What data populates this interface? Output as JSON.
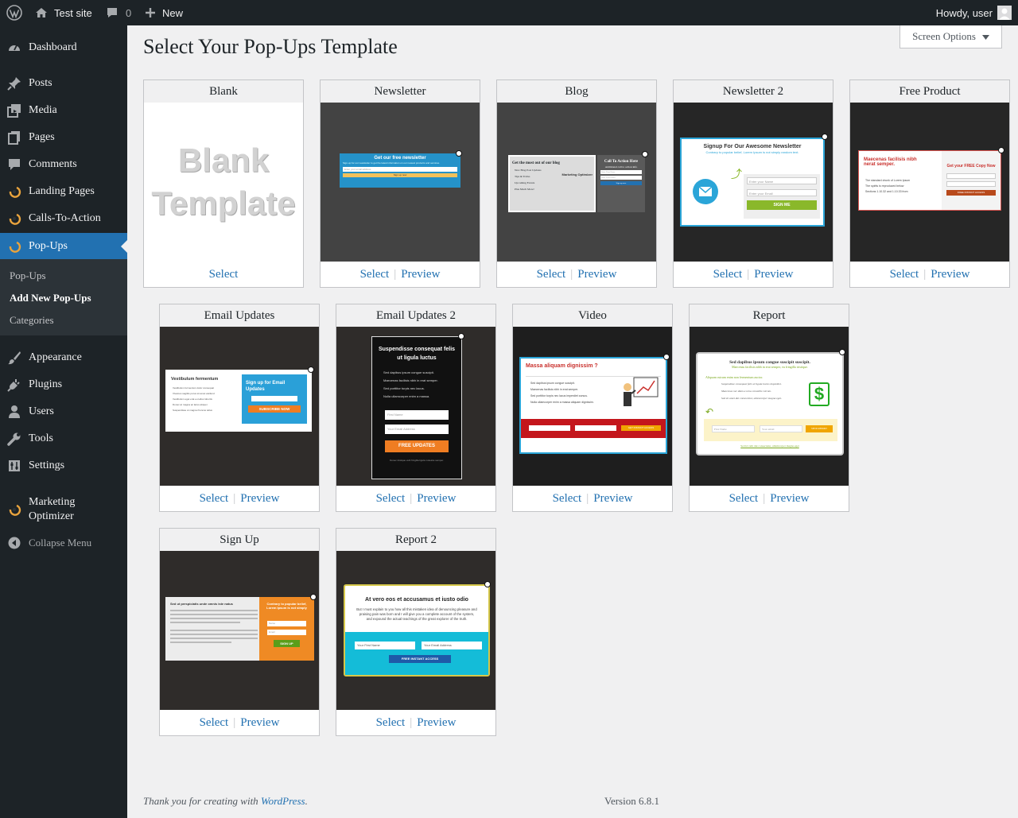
{
  "admin_bar": {
    "site_name": "Test site",
    "comments_count": "0",
    "new_label": "New",
    "greeting": "Howdy, user"
  },
  "sidebar": {
    "items": [
      {
        "label": "Dashboard",
        "icon": "dashboard-icon"
      },
      {
        "label": "Posts",
        "icon": "pin-icon"
      },
      {
        "label": "Media",
        "icon": "media-icon"
      },
      {
        "label": "Pages",
        "icon": "pages-icon"
      },
      {
        "label": "Comments",
        "icon": "comment-icon"
      },
      {
        "label": "Landing Pages",
        "icon": "inbound-icon"
      },
      {
        "label": "Calls-To-Action",
        "icon": "inbound-icon"
      },
      {
        "label": "Pop-Ups",
        "icon": "inbound-icon"
      },
      {
        "label": "Appearance",
        "icon": "brush-icon"
      },
      {
        "label": "Plugins",
        "icon": "plug-icon"
      },
      {
        "label": "Users",
        "icon": "user-icon"
      },
      {
        "label": "Tools",
        "icon": "wrench-icon"
      },
      {
        "label": "Settings",
        "icon": "settings-icon"
      },
      {
        "label": "Marketing Optimizer",
        "icon": "inbound-icon"
      },
      {
        "label": "Collapse Menu",
        "icon": "collapse-icon"
      }
    ],
    "submenu": [
      "Pop-Ups",
      "Add New Pop-Ups",
      "Categories"
    ]
  },
  "page_title": "Select Your Pop-Ups Template",
  "screen_options_label": "Screen Options",
  "select_label": "Select",
  "preview_label": "Preview",
  "templates": [
    {
      "name": "Blank",
      "blank_text": "Blank Template"
    },
    {
      "name": "Newsletter",
      "heading": "Get our free newsletter",
      "body": "Sign-up for our newsletter to get the latest information on our newest products and services.",
      "placeholder": "Enter your email address",
      "button": "Sign up now"
    },
    {
      "name": "Blog",
      "heading": "Get the most out of our blog",
      "bullets": [
        "New Blog Post Updates",
        "Tips & Tricks",
        "Upcoming Events",
        "Plus Much More!"
      ],
      "brand": "Marketing Optimizer",
      "cta_title": "Call To Action Here",
      "cta_sub": "Additional call to action info",
      "field1": "Enter Your Name",
      "field2": "Enter Your Email",
      "button": "Sign up now"
    },
    {
      "name": "Newsletter 2",
      "heading": "Signup For Our Awesome Newsletter",
      "sub": "Contrary to popular belief, Lorem Ipsum is not simply random text.",
      "field1": "Enter your Name",
      "field2": "Enter your Email",
      "button": "SIGN ME"
    },
    {
      "name": "Free Product",
      "heading": "Maecenas facilisis nibh nerat semper.",
      "bullets": [
        "The standard chunk of Lorem Ipsum",
        "The spirits is reproduced below",
        "Sections 1.10.32 and 1.10.33 from"
      ],
      "title2": "Get your FREE Copy Now",
      "button": "FREE INSTANT ACCESS"
    },
    {
      "name": "Email Updates",
      "heading": "Vestibulum fermentum",
      "bullets": [
        "Vestibulum fermentum dolor consequat",
        "Vivamus sagittis purus sit amet eleifend",
        "Vestibulum eget erat eu tellus lobortis",
        "Donec at magna ac lacus aliquet",
        "Suspendisse ut magna rhoncus tellus"
      ],
      "box_title": "Sign up for Email Updates",
      "button": "SUBSCRIBE NOW"
    },
    {
      "name": "Email Updates 2",
      "heading": "Suspendisse consequat felis ut ligula luctus",
      "bullets": [
        "Sed dapibus ipsum congue suscipit.",
        "Maecenas facilisis nibh in erat semper.",
        "Sed porttitor turpis nec lacus.",
        "Nulla ullamcorper enim a massa."
      ],
      "field1": "First Name",
      "field2": "Your Email Address",
      "button": "FREE UPDATES",
      "foot": "Donec tristique velit fringilla ligula molestie semper."
    },
    {
      "name": "Video",
      "heading": "Massa aliquam dignissim ?",
      "bullets": [
        "Sed dapibus ipsum congue suscipit.",
        "Maecenas facilisis nibh in erat semper.",
        "Sed porttitor turpis nec lacus imperdiet cursus.",
        "Nulla ullamcorper enim a massa aliquam dignissim."
      ],
      "button": "GET INSTANT ACCESS"
    },
    {
      "name": "Report",
      "heading": "Sed dapibus ipsum congue suscipit suscipit.",
      "sub": "Maecenas facilisis nibh in erat semper, eu fringilla tristique.",
      "intro": "Aliquam rutrum enim non fermentum auctor.",
      "bullets": [
        "Suspendisse consequat felis ut ligula luctus imperdiet.",
        "Maecenas nec diam a urna convallis rutrum.",
        "Sed sit amet dui consectetur, ullamcorper magna eget."
      ],
      "field1": "First Name",
      "field2": "Your email",
      "button": "SEND REPORT",
      "foot": "Sed id velit dui consectetur, ullamcorper magna eget"
    },
    {
      "name": "Sign Up",
      "heading": "Sed ut perspiciatis unde omnis iste natus",
      "box_title": "Contrary to popular belief, Lorem Ipsum is not simply",
      "field1": "Name",
      "field2": "Email",
      "button": "SIGN UP"
    },
    {
      "name": "Report 2",
      "heading": "At vero eos et accusamus et iusto odio",
      "body": "But I must explain to you how all this mistaken idea of denouncing pleasure and praising pain was born and I will give you a complete account of the system, and expound the actual teachings of the great explorer of the truth.",
      "field1": "Your First Name",
      "field2": "Your Email Address",
      "button": "FREE INSTANT ACCESS"
    }
  ],
  "footer": {
    "thanks_prefix": "Thank you for creating with",
    "thanks_link": "WordPress",
    "thanks_suffix": ".",
    "version": "Version 6.8.1"
  },
  "colors": {
    "admin_dark": "#1d2327",
    "accent": "#2271b1",
    "submenu_bg": "#2c3338",
    "page_bg": "#f0f0f1"
  }
}
